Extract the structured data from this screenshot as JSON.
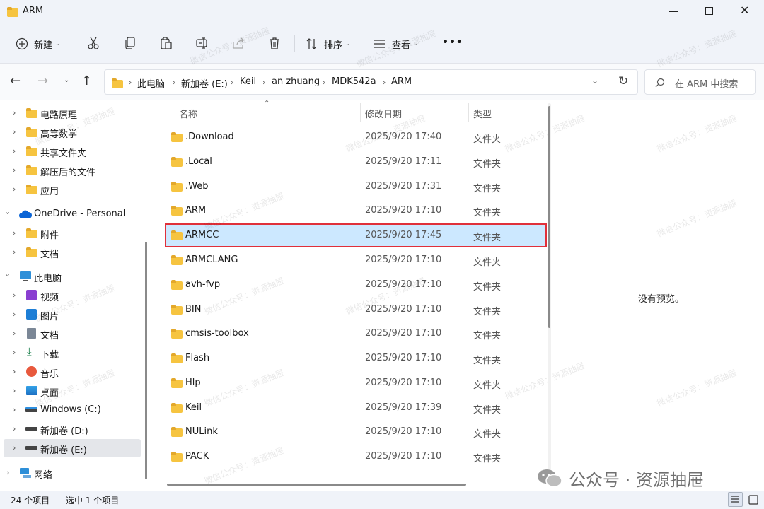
{
  "window": {
    "title": "ARM"
  },
  "toolbar": {
    "new_label": "新建",
    "sort_label": "排序",
    "view_label": "查看",
    "more_label": "•••"
  },
  "address": {
    "segments": [
      "此电脑",
      "新加卷 (E:)",
      "Keil",
      "an zhuang",
      "MDK542a",
      "ARM"
    ],
    "search_placeholder": "在 ARM 中搜索"
  },
  "sidebar": {
    "items": [
      {
        "label": "电路原理",
        "icon": "folder-icon"
      },
      {
        "label": "高等数学",
        "icon": "folder-icon"
      },
      {
        "label": "共享文件夹",
        "icon": "shared-folder-icon"
      },
      {
        "label": "解压后的文件",
        "icon": "folder-icon"
      },
      {
        "label": "应用",
        "icon": "apps-folder-icon"
      },
      {
        "label": "OneDrive - Personal",
        "icon": "onedrive-cloud-icon"
      },
      {
        "label": "附件",
        "icon": "folder-icon"
      },
      {
        "label": "文档",
        "icon": "folder-icon"
      },
      {
        "label": "此电脑",
        "icon": "computer-icon"
      },
      {
        "label": "视频",
        "icon": "videos-icon"
      },
      {
        "label": "图片",
        "icon": "pictures-icon"
      },
      {
        "label": "文档",
        "icon": "documents-icon"
      },
      {
        "label": "下载",
        "icon": "download-icon"
      },
      {
        "label": "音乐",
        "icon": "music-icon"
      },
      {
        "label": "桌面",
        "icon": "desktop-icon"
      },
      {
        "label": "Windows (C:)",
        "icon": "windows-drive-icon"
      },
      {
        "label": "新加卷 (D:)",
        "icon": "drive-icon"
      },
      {
        "label": "新加卷 (E:)",
        "icon": "drive-icon"
      },
      {
        "label": "网络",
        "icon": "network-icon"
      }
    ]
  },
  "columns": {
    "name": "名称",
    "date": "修改日期",
    "type": "类型"
  },
  "files": [
    {
      "name": ".Download",
      "date": "2025/9/20 17:40",
      "type": "文件夹"
    },
    {
      "name": ".Local",
      "date": "2025/9/20 17:11",
      "type": "文件夹"
    },
    {
      "name": ".Web",
      "date": "2025/9/20 17:31",
      "type": "文件夹"
    },
    {
      "name": "ARM",
      "date": "2025/9/20 17:10",
      "type": "文件夹"
    },
    {
      "name": "ARMCC",
      "date": "2025/9/20 17:45",
      "type": "文件夹"
    },
    {
      "name": "ARMCLANG",
      "date": "2025/9/20 17:10",
      "type": "文件夹"
    },
    {
      "name": "avh-fvp",
      "date": "2025/9/20 17:10",
      "type": "文件夹"
    },
    {
      "name": "BIN",
      "date": "2025/9/20 17:10",
      "type": "文件夹"
    },
    {
      "name": "cmsis-toolbox",
      "date": "2025/9/20 17:10",
      "type": "文件夹"
    },
    {
      "name": "Flash",
      "date": "2025/9/20 17:10",
      "type": "文件夹"
    },
    {
      "name": "Hlp",
      "date": "2025/9/20 17:10",
      "type": "文件夹"
    },
    {
      "name": "Keil",
      "date": "2025/9/20 17:39",
      "type": "文件夹"
    },
    {
      "name": "NULink",
      "date": "2025/9/20 17:10",
      "type": "文件夹"
    },
    {
      "name": "PACK",
      "date": "2025/9/20 17:10",
      "type": "文件夹"
    }
  ],
  "preview": {
    "text": "没有预览。"
  },
  "status": {
    "count": "24 个项目",
    "selected": "选中 1 个项目"
  },
  "watermark": {
    "small": "微信公众号：资源抽屉",
    "badge": "公众号 · 资源抽屉"
  },
  "colors": {
    "selection": "#cce8ff",
    "highlight_box": "#e0303a",
    "folder": "#f6c440",
    "accent": "#0067c0"
  }
}
